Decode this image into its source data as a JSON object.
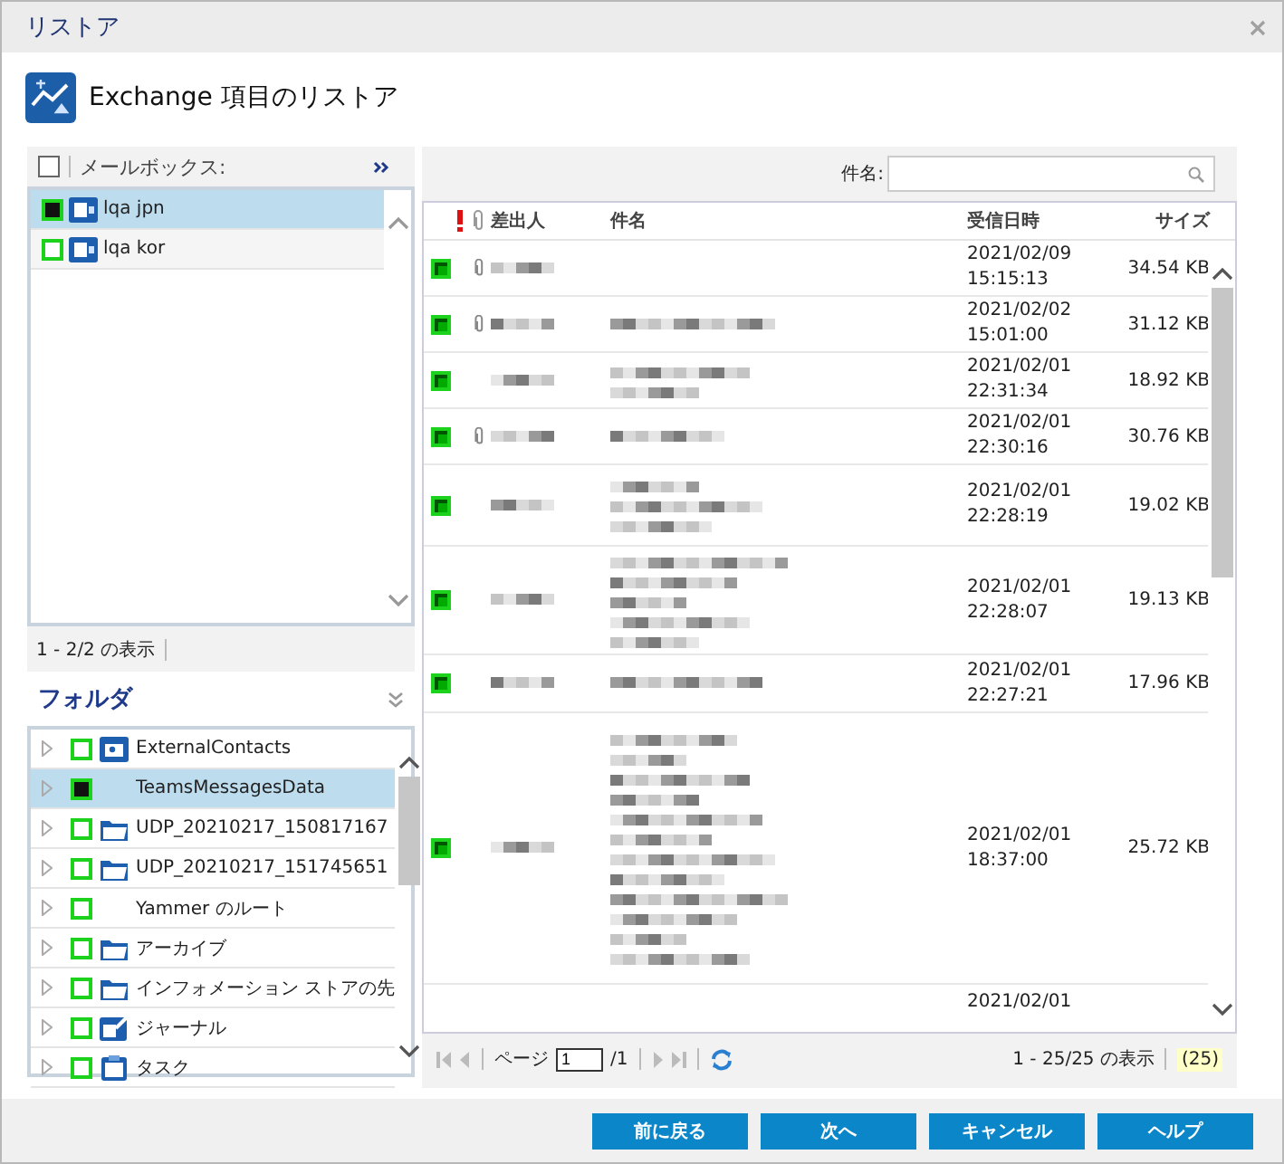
{
  "window": {
    "title": "リストア"
  },
  "header": {
    "title": "Exchange 項目のリストア"
  },
  "mailboxes": {
    "label": "メールボックス:",
    "checked": false,
    "status": "1 - 2/2 の表示",
    "items": [
      {
        "name": "lqa jpn",
        "checked": true,
        "selected": true
      },
      {
        "name": "lqa kor",
        "checked": false,
        "selected": false
      }
    ]
  },
  "folders": {
    "label": "フォルダ",
    "items": [
      {
        "name": "ExternalContacts",
        "kind": "contacts",
        "checked": false,
        "selected": false
      },
      {
        "name": "TeamsMessagesData",
        "kind": "plain",
        "checked": true,
        "selected": true
      },
      {
        "name": "UDP_20210217_150817167",
        "kind": "folder",
        "checked": false,
        "selected": false
      },
      {
        "name": "UDP_20210217_151745651",
        "kind": "folder",
        "checked": false,
        "selected": false
      },
      {
        "name": "Yammer のルート",
        "kind": "plain",
        "checked": false,
        "selected": false
      },
      {
        "name": "アーカイブ",
        "kind": "folder",
        "checked": false,
        "selected": false
      },
      {
        "name": "インフォメーション ストアの先",
        "kind": "folder",
        "checked": false,
        "selected": false
      },
      {
        "name": "ジャーナル",
        "kind": "journal",
        "checked": false,
        "selected": false
      },
      {
        "name": "タスク",
        "kind": "task",
        "checked": false,
        "selected": false
      }
    ]
  },
  "search": {
    "label": "件名:"
  },
  "table": {
    "columns": [
      "差出人",
      "件名",
      "受信日時",
      "サイズ"
    ],
    "rows": [
      {
        "checked": true,
        "attachment": true,
        "date": "2021/02/09",
        "time": "15:15:13",
        "size": "34.54 KB"
      },
      {
        "checked": true,
        "attachment": true,
        "date": "2021/02/02",
        "time": "15:01:00",
        "size": "31.12 KB"
      },
      {
        "checked": true,
        "attachment": false,
        "date": "2021/02/01",
        "time": "22:31:34",
        "size": "18.92 KB"
      },
      {
        "checked": true,
        "attachment": true,
        "date": "2021/02/01",
        "time": "22:30:16",
        "size": "30.76 KB"
      },
      {
        "checked": true,
        "attachment": false,
        "date": "2021/02/01",
        "time": "22:28:19",
        "size": "19.02 KB"
      },
      {
        "checked": true,
        "attachment": false,
        "date": "2021/02/01",
        "time": "22:28:07",
        "size": "19.13 KB"
      },
      {
        "checked": true,
        "attachment": false,
        "date": "2021/02/01",
        "time": "22:27:21",
        "size": "17.96 KB"
      },
      {
        "checked": true,
        "attachment": false,
        "date": "2021/02/01",
        "time": "18:37:00",
        "size": "25.72 KB"
      },
      {
        "date": "2021/02/01"
      }
    ]
  },
  "pager": {
    "page_label": "ページ",
    "page": "1",
    "of": "/1",
    "status": "1 - 25/25 の表示",
    "count": "(25)"
  },
  "buttons": [
    "前に戻る",
    "次へ",
    "キャンセル",
    "ヘルプ"
  ]
}
